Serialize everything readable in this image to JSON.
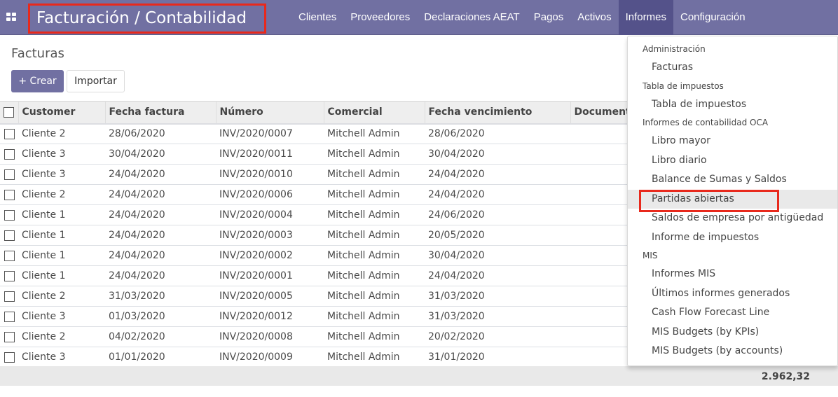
{
  "navbar": {
    "apps_icon": "apps-grid-icon",
    "brand": "Facturación / Contabilidad",
    "menu": [
      {
        "label": "Clientes",
        "active": false
      },
      {
        "label": "Proveedores",
        "active": false
      },
      {
        "label": "Declaraciones AEAT",
        "active": false
      },
      {
        "label": "Pagos",
        "active": false
      },
      {
        "label": "Activos",
        "active": false
      },
      {
        "label": "Informes",
        "active": true
      },
      {
        "label": "Configuración",
        "active": false
      }
    ]
  },
  "page": {
    "title": "Facturas",
    "create_label": "+ Crear",
    "import_label": "Importar"
  },
  "table": {
    "columns": [
      "Customer",
      "Fecha factura",
      "Número",
      "Comercial",
      "Fecha vencimiento",
      "Document"
    ],
    "rows": [
      {
        "customer": "Cliente 2",
        "date": "28/06/2020",
        "number": "INV/2020/0007",
        "salesperson": "Mitchell Admin",
        "due": "28/06/2020"
      },
      {
        "customer": "Cliente 3",
        "date": "30/04/2020",
        "number": "INV/2020/0011",
        "salesperson": "Mitchell Admin",
        "due": "30/04/2020"
      },
      {
        "customer": "Cliente 3",
        "date": "24/04/2020",
        "number": "INV/2020/0010",
        "salesperson": "Mitchell Admin",
        "due": "24/04/2020"
      },
      {
        "customer": "Cliente 2",
        "date": "24/04/2020",
        "number": "INV/2020/0006",
        "salesperson": "Mitchell Admin",
        "due": "24/04/2020"
      },
      {
        "customer": "Cliente 1",
        "date": "24/04/2020",
        "number": "INV/2020/0004",
        "salesperson": "Mitchell Admin",
        "due": "24/06/2020"
      },
      {
        "customer": "Cliente 1",
        "date": "24/04/2020",
        "number": "INV/2020/0003",
        "salesperson": "Mitchell Admin",
        "due": "20/05/2020"
      },
      {
        "customer": "Cliente 1",
        "date": "24/04/2020",
        "number": "INV/2020/0002",
        "salesperson": "Mitchell Admin",
        "due": "30/04/2020"
      },
      {
        "customer": "Cliente 1",
        "date": "24/04/2020",
        "number": "INV/2020/0001",
        "salesperson": "Mitchell Admin",
        "due": "24/04/2020"
      },
      {
        "customer": "Cliente 2",
        "date": "31/03/2020",
        "number": "INV/2020/0005",
        "salesperson": "Mitchell Admin",
        "due": "31/03/2020"
      },
      {
        "customer": "Cliente 3",
        "date": "01/03/2020",
        "number": "INV/2020/0012",
        "salesperson": "Mitchell Admin",
        "due": "31/03/2020"
      },
      {
        "customer": "Cliente 2",
        "date": "04/02/2020",
        "number": "INV/2020/0008",
        "salesperson": "Mitchell Admin",
        "due": "20/02/2020"
      },
      {
        "customer": "Cliente 3",
        "date": "01/01/2020",
        "number": "INV/2020/0009",
        "salesperson": "Mitchell Admin",
        "due": "31/01/2020"
      }
    ],
    "total": "2.962,32"
  },
  "dropdown": {
    "sections": [
      {
        "header": "Administración",
        "items": [
          "Facturas"
        ]
      },
      {
        "header": "Tabla de impuestos",
        "items": [
          "Tabla de impuestos"
        ]
      },
      {
        "header": "Informes de contabilidad OCA",
        "items": [
          "Libro mayor",
          "Libro diario",
          "Balance de Sumas y Saldos",
          "Partidas abiertas",
          "Saldos de empresa por antigüedad",
          "Informe de impuestos"
        ]
      },
      {
        "header": "MIS",
        "items": [
          "Informes MIS",
          "Últimos informes generados",
          "Cash Flow Forecast Line",
          "MIS Budgets (by KPIs)",
          "MIS Budgets (by accounts)"
        ]
      }
    ],
    "hovered_item": "Partidas abiertas"
  },
  "colors": {
    "brand": "#7170a2",
    "menu_active": "#54528a",
    "annotation": "#e8291c"
  }
}
